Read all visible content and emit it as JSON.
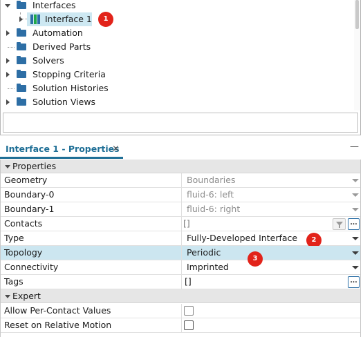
{
  "tree": {
    "items": [
      {
        "label": "Interfaces",
        "expanded": true
      },
      {
        "label": "Interface 1"
      },
      {
        "label": "Automation",
        "expanded": false
      },
      {
        "label": "Derived Parts",
        "expanded": false
      },
      {
        "label": "Solvers",
        "expanded": false
      },
      {
        "label": "Stopping Criteria",
        "expanded": false
      },
      {
        "label": "Solution Histories",
        "expanded": false
      },
      {
        "label": "Solution Views",
        "expanded": false
      }
    ]
  },
  "callouts": [
    "1",
    "2",
    "3"
  ],
  "properties_panel": {
    "tab_title": "Interface 1 - Properties",
    "close_glyph": "×",
    "minimize_glyph": "—",
    "categories": {
      "properties": "Properties",
      "expert": "Expert"
    },
    "rows": [
      {
        "name": "Geometry",
        "value": "Boundaries"
      },
      {
        "name": "Boundary-0",
        "value": "fluid-6: left"
      },
      {
        "name": "Boundary-1",
        "value": "fluid-6: right"
      },
      {
        "name": "Contacts",
        "value": "[]"
      },
      {
        "name": "Type",
        "value": "Fully-Developed Interface"
      },
      {
        "name": "Topology",
        "value": "Periodic"
      },
      {
        "name": "Connectivity",
        "value": "Imprinted"
      },
      {
        "name": "Tags",
        "value": "[]"
      }
    ],
    "expert_rows": [
      {
        "name": "Allow Per-Contact Values",
        "checked": false
      },
      {
        "name": "Reset on Relative Motion",
        "checked": false
      }
    ],
    "ellipsis_label": "...",
    "selected_row": "Topology"
  },
  "colors": {
    "accent": "#1f6f96",
    "folder": "#2d6ea5",
    "selection": "#cce6f0",
    "callout": "#e2231a"
  }
}
